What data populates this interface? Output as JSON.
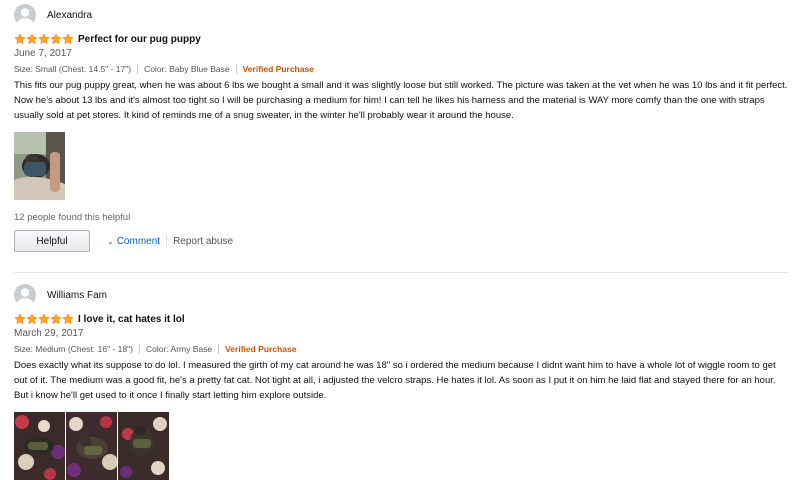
{
  "colors": {
    "star": "#ffa41c",
    "verified": "#c45500",
    "link": "#0066c0",
    "avatar": "#c9cdd1"
  },
  "reviews": [
    {
      "author": "Alexandra",
      "rating": 5,
      "title": "Perfect for our pug puppy",
      "date": "June 7, 2017",
      "size": "Size: Small (Chest: 14.5\" - 17\")",
      "color": "Color: Baby Blue Base",
      "verified": "Verified Purchase",
      "body": "This fits our pug puppy great, when he was about 6 lbs we bought a small and it was slightly loose but still worked. The picture was taken at the vet when he was 10 lbs and it fit perfect. Now he's about 13 lbs and it's almost too tight so I will be purchasing a medium for him! I can tell he likes his harness and the material is WAY more comfy than the one with straps usually sold at pet stores. It kind of reminds me of a snug sweater, in the winter he'll probably wear it around the house.",
      "helpful_count": "12 people found this helpful",
      "helpful_button": "Helpful",
      "comment": "Comment",
      "report": "Report abuse",
      "photos": [
        "pug-in-harness-photo"
      ]
    },
    {
      "author": "Williams Fam",
      "rating": 5,
      "title": "I love it, cat hates it lol",
      "date": "March 29, 2017",
      "size": "Size: Medium (Chest: 16\" - 18\")",
      "color": "Color: Army Base",
      "verified": "Verified Purchase",
      "body": "Does exactly what its suppose to do lol. I measured the girth of my cat around he was 18\" so i ordered the medium because I didnt want him to have a whole lot of wiggle room to get out of it. The medium was a good fit, he's a pretty fat cat. Not tight at all, i adjusted the velcro straps. He hates it lol. As soon as I put it on him he laid flat and stayed there for an hour. But i know he'll get used to it once I finally start letting him explore outside.",
      "photos": [
        "cat-on-rug-photo-1",
        "cat-on-rug-photo-2",
        "cat-on-rug-photo-3"
      ]
    }
  ]
}
